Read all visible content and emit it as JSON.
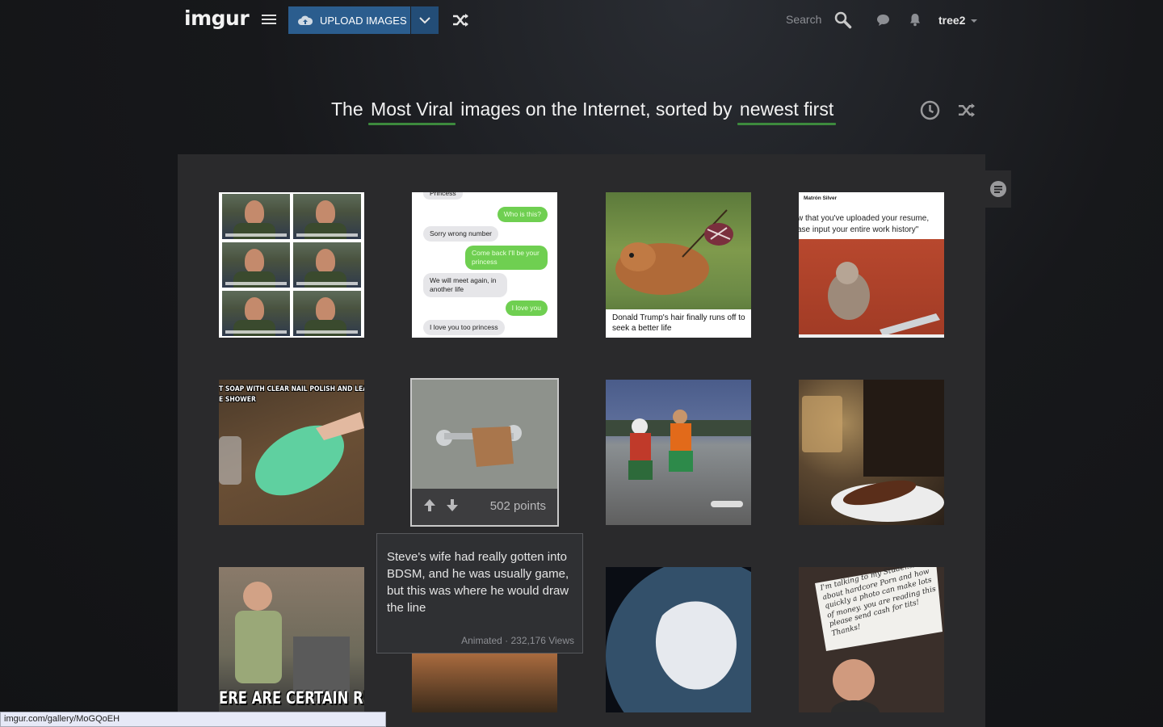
{
  "header": {
    "logo": "imgur",
    "upload_label": "UPLOAD IMAGES",
    "search_label": "Search",
    "username": "tree2"
  },
  "headline": {
    "prefix": "The",
    "section": "Most Viral",
    "middle": "images on the Internet, sorted by",
    "sort": "newest first"
  },
  "gallery": {
    "texts_thumb": {
      "messages": [
        {
          "from": "other",
          "text": "Princess"
        },
        {
          "from": "me",
          "text": "Who is this?"
        },
        {
          "from": "other",
          "text": "Sorry wrong number"
        },
        {
          "from": "me",
          "text": "Come back I'll be your princess"
        },
        {
          "from": "other",
          "text": "We will meet again, in another life"
        },
        {
          "from": "me",
          "text": "I love you"
        },
        {
          "from": "other",
          "text": "I love you too princess"
        }
      ]
    },
    "trump_caption": "Donald Trump's hair finally runs off to seek a better life",
    "tweet": {
      "name": "Matrón Silver",
      "line1": "w that you've uploaded your resume,",
      "line2": "ase input your entire work history\""
    },
    "soap_caption": {
      "line1": "T SOAP WITH CLEAR NAIL POLISH AND LEAVE",
      "line2": "E SHOWER"
    },
    "hovered": {
      "points": "502 points",
      "title": "Steve's wife had really gotten into BDSM, and he was usually game, but this was where he would draw the line",
      "meta": "Animated · 232,176 Views"
    },
    "ron_caption": "ERE ARE CERTAIN RU",
    "sign_text": "I'm talking to my Students about hardcore Porn and how quickly a photo can make lots of money. you are reading this please send cash for tits! Thanks!"
  },
  "status_url": "imgur.com/gallery/MoGQoEH",
  "colors": {
    "upload_blue": "#2b5d8e",
    "accent_green": "#3d8a3d",
    "gallery_bg": "#2a2a2c"
  }
}
